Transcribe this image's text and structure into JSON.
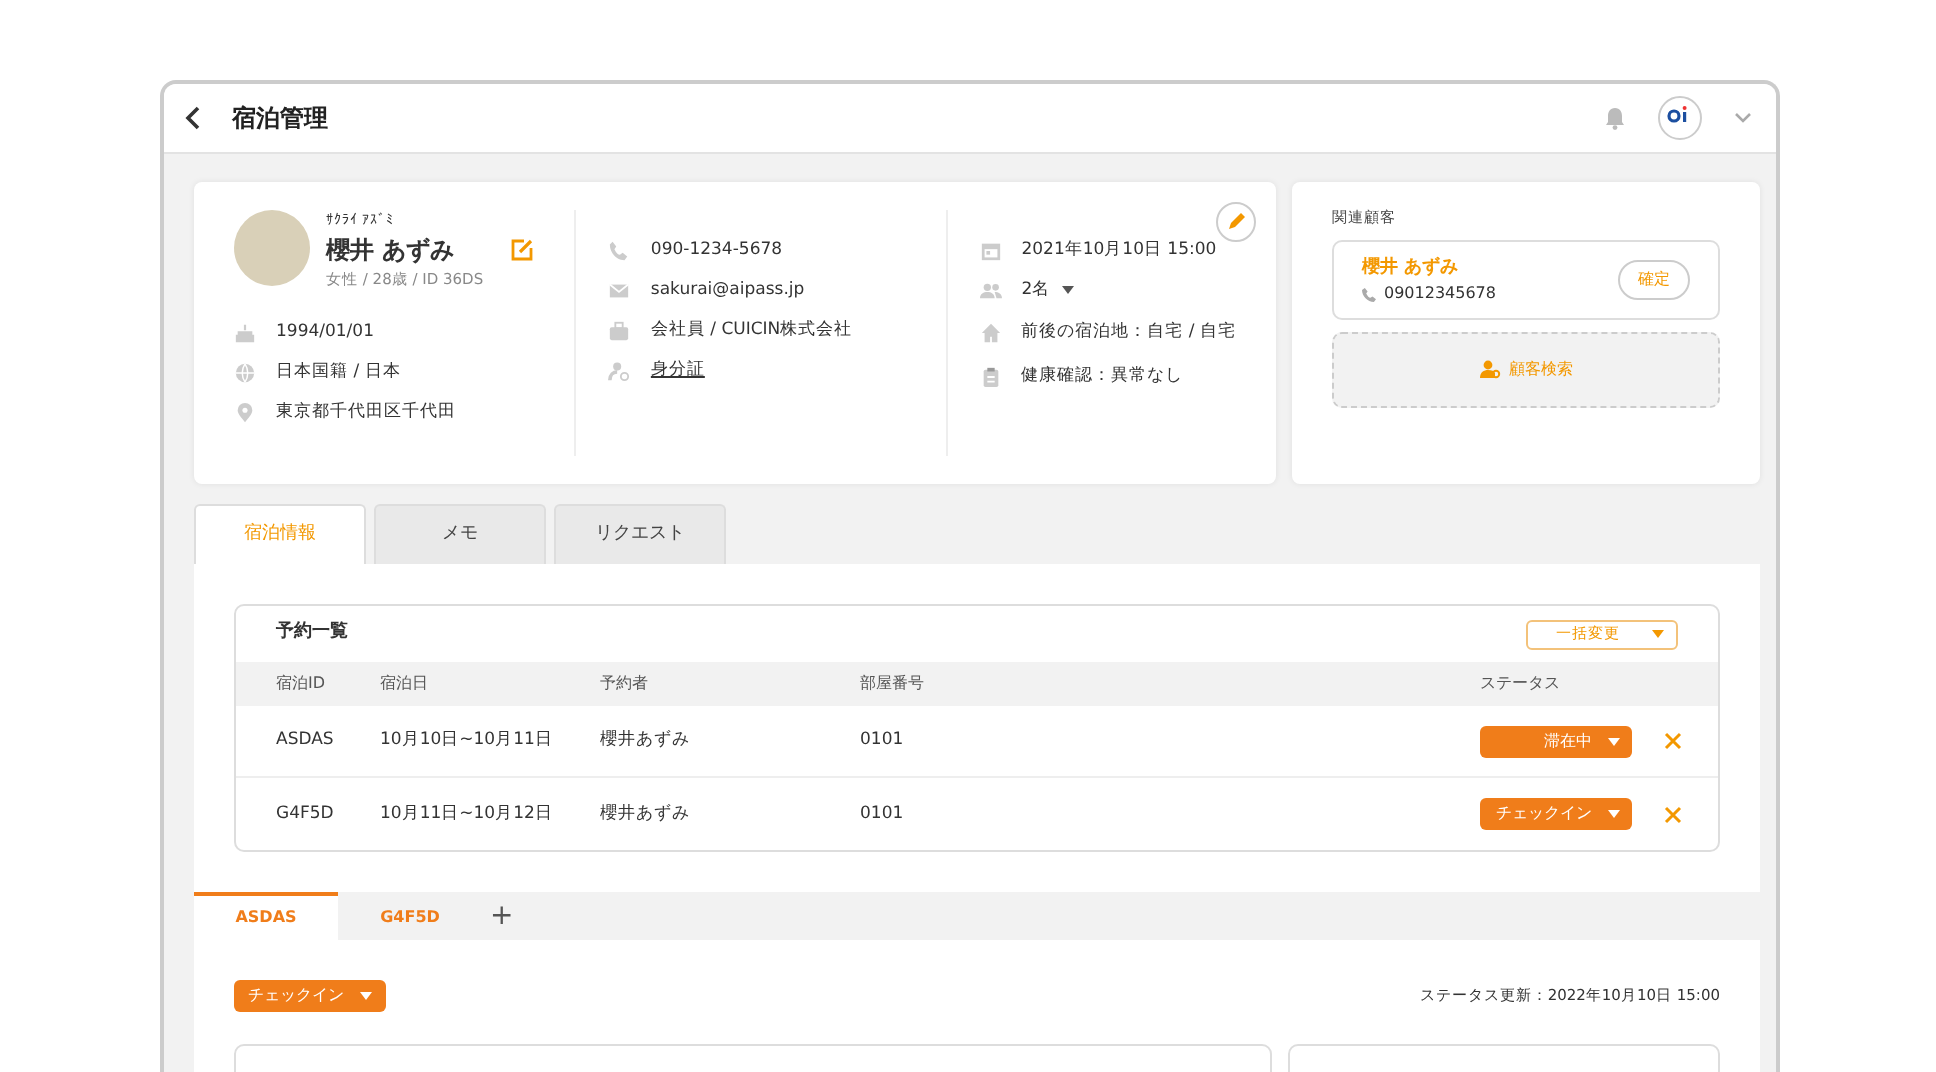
{
  "header": {
    "title": "宿泊管理"
  },
  "profile": {
    "kana": "ｻｸﾗｲ ｱｽﾞﾐ",
    "name": "櫻井 あずみ",
    "meta": "女性 / 28歳 / ID 36DS",
    "birthdate": "1994/01/01",
    "nationality": "日本国籍 / 日本",
    "address": "東京都千代田区千代田",
    "phone": "090-1234-5678",
    "email": "sakurai@aipass.jp",
    "work": "会社員 / CUICIN株式会社",
    "id_link": "身分証",
    "checkin": "2021年10月10日 15:00",
    "guests": "2名",
    "stay": "前後の宿泊地：自宅 / 自宅",
    "health": "健康確認：異常なし"
  },
  "related": {
    "title": "関連顧客",
    "customer_name": "櫻井 あずみ",
    "customer_phone": "09012345678",
    "confirm_button": "確定",
    "search_button": "顧客検索"
  },
  "tabs": [
    {
      "label": "宿泊情報",
      "selected": true
    },
    {
      "label": "メモ",
      "selected": false
    },
    {
      "label": "リクエスト",
      "selected": false
    }
  ],
  "reservations": {
    "title": "予約一覧",
    "bulk_button": "一括変更",
    "columns": [
      "宿泊ID",
      "宿泊日",
      "予約者",
      "部屋番号",
      "ステータス"
    ],
    "rows": [
      {
        "id": "ASDAS",
        "dates": "10月10日~10月11日",
        "booker": "櫻井あずみ",
        "room": "0101",
        "status": "滞在中"
      },
      {
        "id": "G4F5D",
        "dates": "10月11日~10月12日",
        "booker": "櫻井あずみ",
        "room": "0101",
        "status": "チェックイン"
      }
    ]
  },
  "sub_tabs": [
    {
      "label": "ASDAS",
      "selected": true
    },
    {
      "label": "G4F5D",
      "selected": false
    }
  ],
  "add_tab": "+",
  "status_button": "チェックイン",
  "status_updated": "ステータス更新：2022年10月10日 15:00"
}
